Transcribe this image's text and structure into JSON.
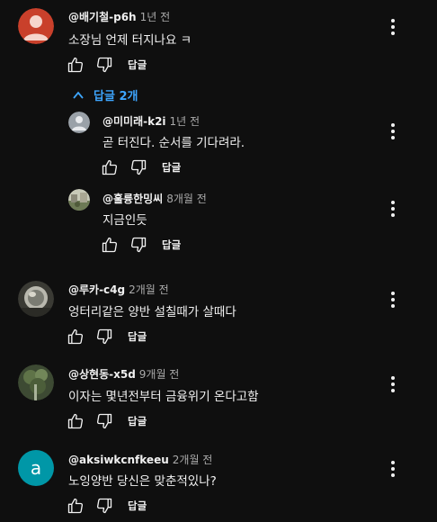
{
  "colors": {
    "background": "#0f0f0f",
    "text": "#f1f1f1",
    "secondary": "#aaaaaa",
    "link": "#3ea6ff"
  },
  "comments": [
    {
      "author": "@배기철-p6h",
      "time": "1년 전",
      "text": "소장님 언제 터지나요 ㅋ",
      "reply_label": "답글",
      "avatar_kind": "default-red"
    },
    {
      "author": "@루카-c4g",
      "time": "2개월 전",
      "text": "엉터리같은 양반 설칠때가 살때다",
      "reply_label": "답글",
      "avatar_kind": "photo-mirror"
    },
    {
      "author": "@상현동-x5d",
      "time": "9개월 전",
      "text": "이자는 몇년전부터 금융위기 온다고함",
      "reply_label": "답글",
      "avatar_kind": "photo-tree"
    },
    {
      "author": "@aksiwkcnfkeeu",
      "time": "2개월 전",
      "text": "노잉양반 당신은 맞춘적있나?",
      "reply_label": "답글",
      "avatar_kind": "letter",
      "avatar_letter": "a",
      "avatar_color": "#0097a7"
    }
  ],
  "replies_toggle": {
    "label": "답글 2개",
    "icon": "chevron-up-icon"
  },
  "replies": [
    {
      "author": "@미미래-k2i",
      "time": "1년 전",
      "text": "곧 터진다. 순서를 기다려라.",
      "reply_label": "답글",
      "avatar_kind": "default-gray"
    },
    {
      "author": "@훌륭한밍씨",
      "time": "8개월 전",
      "text": "지금인듯",
      "reply_label": "답글",
      "avatar_kind": "photo-scene"
    }
  ]
}
